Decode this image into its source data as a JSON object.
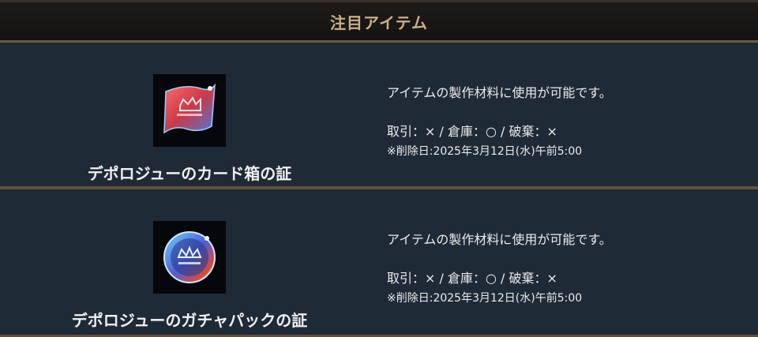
{
  "header": {
    "title": "注目アイテム"
  },
  "items": [
    {
      "name": "デポロジューのカード箱の証",
      "icon": "flag-crown-icon",
      "description": "アイテムの製作材料に使用が可能です。",
      "trade": "取引：× / 倉庫：○ / 破棄：×",
      "delete_date": "※削除日:2025年3月12日(水)午前5:00"
    },
    {
      "name": "デポロジューのガチャパックの証",
      "icon": "medal-crown-icon",
      "description": "アイテムの製作材料に使用が可能です。",
      "trade": "取引：× / 倉庫：○ / 破棄：×",
      "delete_date": "※削除日:2025年3月12日(水)午前5:00"
    }
  ]
}
